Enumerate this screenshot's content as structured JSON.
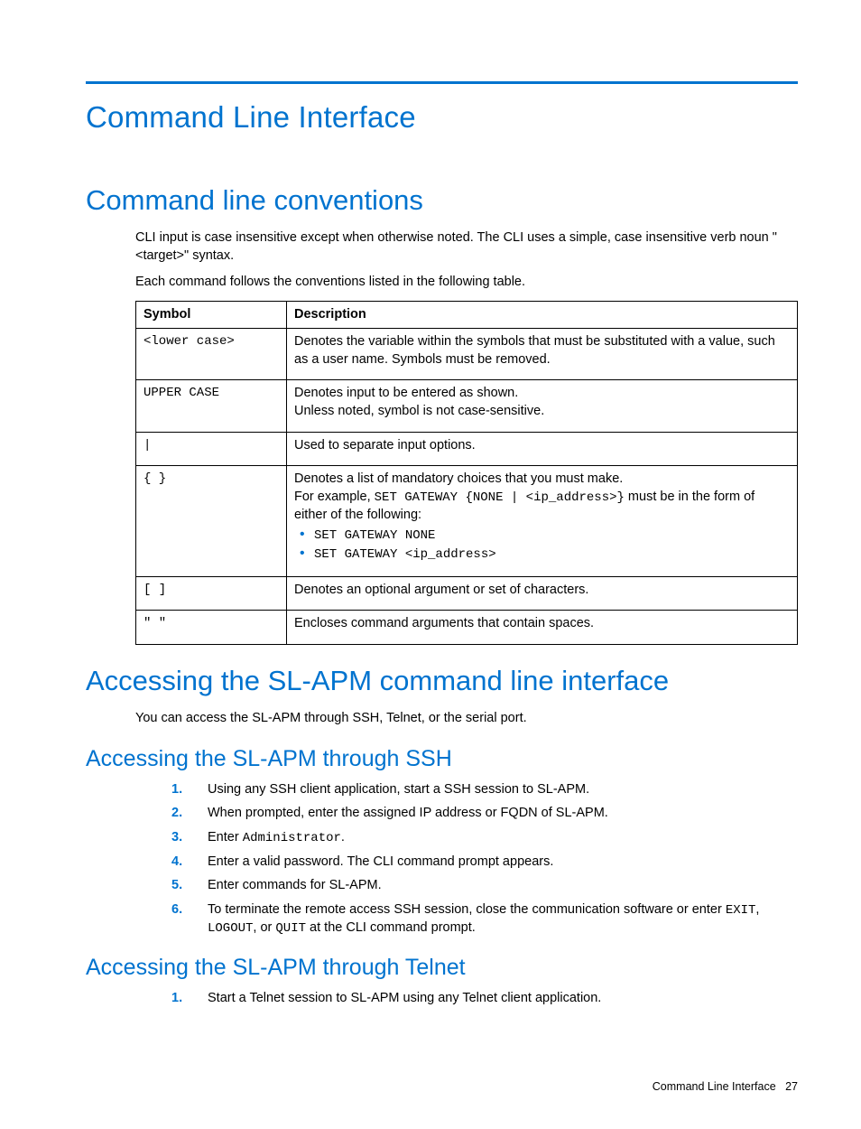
{
  "page_title": "Command Line Interface",
  "section1": {
    "title": "Command line conventions",
    "intro": "CLI input is case insensitive except when otherwise noted. The CLI uses a simple, case insensitive verb noun \"<target>\" syntax.",
    "table_intro": "Each command follows the conventions listed in the following table.",
    "table": {
      "headers": [
        "Symbol",
        "Description"
      ],
      "rows": [
        {
          "symbol": "<lower case>",
          "symbol_mono": true,
          "desc": "Denotes the variable within the symbols that must be substituted with a value, such as a user name. Symbols must be removed."
        },
        {
          "symbol": "UPPER CASE",
          "symbol_mono": true,
          "desc_lines": [
            "Denotes input to be entered as shown.",
            "Unless noted, symbol is not case-sensitive."
          ]
        },
        {
          "symbol": "|",
          "symbol_mono": true,
          "desc": "Used to separate input options."
        },
        {
          "symbol": "{ }",
          "symbol_mono": true,
          "complex": true,
          "line1": "Denotes a list of mandatory choices that you must make.",
          "line2_pre": "For example, ",
          "line2_code": "SET GATEWAY {NONE | <ip_address>}",
          "line2_post": " must be in the form of either of the following:",
          "bullets": [
            "SET GATEWAY NONE",
            "SET GATEWAY <ip_address>"
          ]
        },
        {
          "symbol": "[ ]",
          "symbol_mono": true,
          "desc": "Denotes an optional argument or set of characters."
        },
        {
          "symbol": "\" \"",
          "symbol_mono": true,
          "desc": "Encloses command arguments that contain spaces."
        }
      ]
    }
  },
  "section2": {
    "title": "Accessing the SL-APM command line interface",
    "intro": "You can access the SL-APM through SSH, Telnet, or the serial port.",
    "sub1": {
      "title": "Accessing the SL-APM through SSH",
      "steps": [
        {
          "text": "Using any SSH client application, start a SSH session to SL-APM."
        },
        {
          "text": "When prompted, enter the assigned IP address or FQDN of SL-APM."
        },
        {
          "pre": "Enter ",
          "code": "Administrator",
          "post": "."
        },
        {
          "text": "Enter a valid password. The CLI command prompt appears."
        },
        {
          "text": "Enter commands for SL-APM."
        },
        {
          "pre": "To terminate the remote access SSH session, close the communication software or enter ",
          "code": "EXIT",
          "mid1": ", ",
          "code2": "LOGOUT",
          "mid2": ", or ",
          "code3": "QUIT",
          "post": " at the CLI command prompt."
        }
      ]
    },
    "sub2": {
      "title": "Accessing the SL-APM through Telnet",
      "steps": [
        {
          "text": "Start a Telnet session to SL-APM using any Telnet client application."
        }
      ]
    }
  },
  "footer": {
    "label": "Command Line Interface",
    "page": "27"
  }
}
